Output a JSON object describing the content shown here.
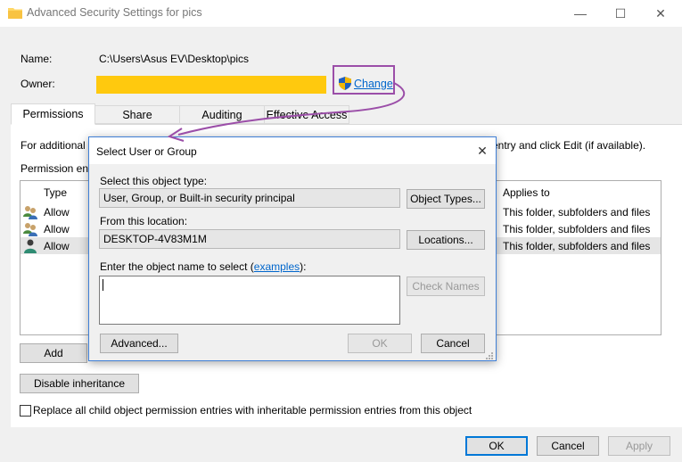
{
  "window": {
    "title": "Advanced Security Settings for pics",
    "minimize_glyph": "—",
    "maximize_glyph": "☐",
    "close_glyph": "✕"
  },
  "info": {
    "name_label": "Name:",
    "name_value": "C:\\Users\\Asus EV\\Desktop\\pics",
    "owner_label": "Owner:",
    "owner_redaction_color": "#ffc90e",
    "change_link": "Change"
  },
  "tabs": [
    {
      "label": "Permissions",
      "active": true
    },
    {
      "label": "Share",
      "active": false
    },
    {
      "label": "Auditing",
      "active": false
    },
    {
      "label": "Effective Access",
      "active": false
    }
  ],
  "permissions": {
    "intro_left": "For additional",
    "intro_right": "entry and click Edit (if available).",
    "entries_label": "Permission ent",
    "col_type": "Type",
    "col_applies": "Applies to",
    "rows": [
      {
        "type": "Allow",
        "applies": "This folder, subfolders and files"
      },
      {
        "type": "Allow",
        "applies": "This folder, subfolders and files"
      },
      {
        "type": "Allow",
        "applies": "This folder, subfolders and files"
      }
    ],
    "add_button": "Add",
    "disable_inheritance_button": "Disable inheritance",
    "replace_checkbox_label": "Replace all child object permission entries with inheritable permission entries from this object"
  },
  "footer": {
    "ok": "OK",
    "cancel": "Cancel",
    "apply": "Apply"
  },
  "dialog": {
    "title": "Select User or Group",
    "close_glyph": "✕",
    "object_type_label": "Select this object type:",
    "object_type_value": "User, Group, or Built-in security principal",
    "object_types_button": "Object Types...",
    "location_label": "From this location:",
    "location_value": "DESKTOP-4V83M1M",
    "locations_button": "Locations...",
    "enter_name_prefix": "Enter the object name to select (",
    "enter_name_link": "examples",
    "enter_name_suffix": "):",
    "enter_name_value": "",
    "check_names_button": "Check Names",
    "advanced_button": "Advanced...",
    "ok_button": "OK",
    "cancel_button": "Cancel"
  },
  "annotation": {
    "highlight_color": "#9b4ea8"
  }
}
